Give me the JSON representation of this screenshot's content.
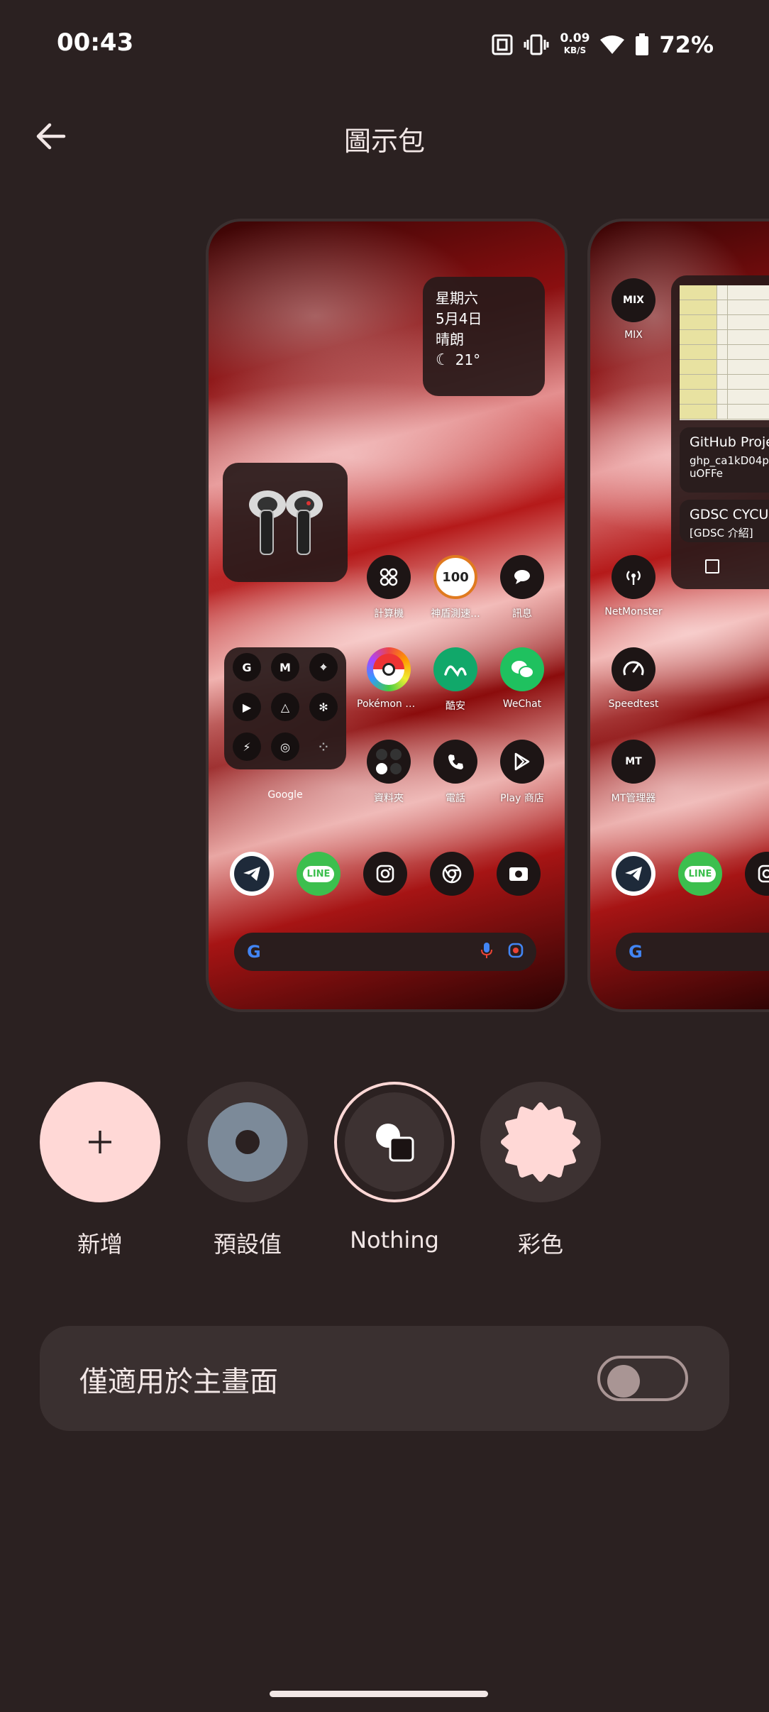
{
  "status_bar": {
    "time": "00:43",
    "net_speed_value": "0.09",
    "net_speed_unit": "KB/S",
    "battery_percent": "72%",
    "icons": [
      "nfc-icon",
      "vibrate-icon",
      "wifi-icon",
      "battery-icon"
    ]
  },
  "header": {
    "title": "圖示包",
    "back_icon": "arrow-left-icon"
  },
  "preview_home": {
    "weather": {
      "day": "星期六",
      "date": "5月4日",
      "condition": "晴朗",
      "temperature": "21°"
    },
    "apps": [
      {
        "label": "計算機",
        "icon": "calculator-icon"
      },
      {
        "label": "神盾測速...",
        "icon": "speed-camera-icon"
      },
      {
        "label": "訊息",
        "icon": "message-icon"
      },
      {
        "label": "Pokémon GO",
        "icon": "pokeball-icon"
      },
      {
        "label": "酷安",
        "icon": "coolapk-icon"
      },
      {
        "label": "WeChat",
        "icon": "wechat-icon"
      },
      {
        "label": "資料夾",
        "icon": "folder-icon"
      },
      {
        "label": "電話",
        "icon": "phone-icon"
      },
      {
        "label": "Play 商店",
        "icon": "play-store-icon"
      }
    ],
    "folder_label": "Google",
    "dock": [
      "telegram-icon",
      "line-icon",
      "instagram-icon",
      "chrome-icon",
      "camera-icon"
    ],
    "dock_line_text": "LINE"
  },
  "preview_second": {
    "apps": [
      {
        "label": "MIX",
        "icon": "mix-icon"
      },
      {
        "label": "NetMonster",
        "icon": "antenna-icon"
      },
      {
        "label": "Speedtest",
        "icon": "gauge-icon"
      },
      {
        "label": "MT管理器",
        "icon": "mt-manager-icon"
      }
    ],
    "notes": [
      {
        "title": "GitHub Proje",
        "body": "ghp_ca1kD04p",
        "body2": "uOFFe"
      },
      {
        "title": "GDSC CYCU",
        "body": "[GDSC 介紹]"
      }
    ],
    "dock_line_text": "LINE"
  },
  "options": [
    {
      "label": "新增",
      "icon": "plus-icon",
      "selected": false
    },
    {
      "label": "預設值",
      "icon": "default-dot-icon",
      "selected": false
    },
    {
      "label": "Nothing",
      "icon": "nothing-shapes-icon",
      "selected": true
    },
    {
      "label": "彩色",
      "icon": "scalloped-shape-icon",
      "selected": false
    }
  ],
  "home_only_toggle": {
    "label": "僅適用於主畫面",
    "enabled": false
  },
  "colors": {
    "background": "#2b2121",
    "accent": "#ffd8d6",
    "surface": "#3a3030"
  }
}
